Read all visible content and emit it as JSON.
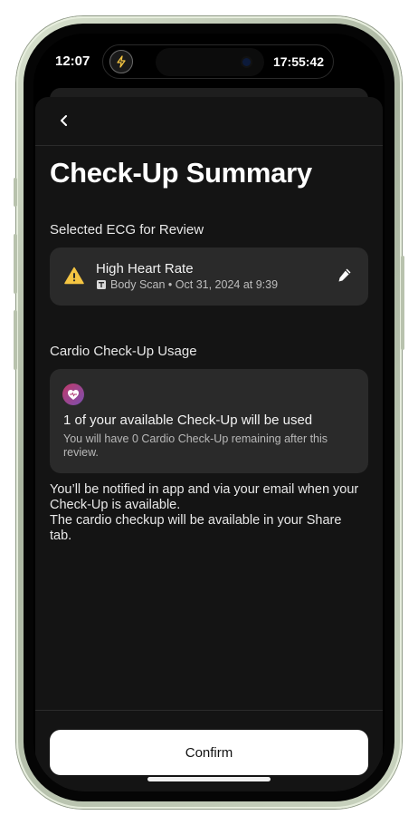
{
  "status_bar": {
    "time": "12:07",
    "island_clock": "17:55:42",
    "island_icon": "bolt-icon"
  },
  "header": {
    "back_icon": "chevron-left-icon"
  },
  "page": {
    "title": "Check-Up Summary"
  },
  "ecg_section": {
    "label": "Selected ECG for Review",
    "card": {
      "title": "High Heart Rate",
      "source_icon": "body-scan-icon",
      "meta": "Body Scan • Oct 31, 2024 at 9:39",
      "status_icon": "warning-icon",
      "status_color": "#f5c542",
      "edit_icon": "pencil-icon"
    }
  },
  "usage_section": {
    "label": "Cardio Check-Up Usage",
    "card": {
      "icon": "heart-badge-icon",
      "title": "1 of your available Check-Up will be used",
      "subtitle": "You will have 0 Cardio Check-Up remaining after this review."
    }
  },
  "notes": {
    "line1": "You’ll be notified in app and via your email when your Check-Up is available.",
    "line2": "The cardio checkup will be available in your Share tab."
  },
  "footer": {
    "confirm_label": "Confirm"
  }
}
